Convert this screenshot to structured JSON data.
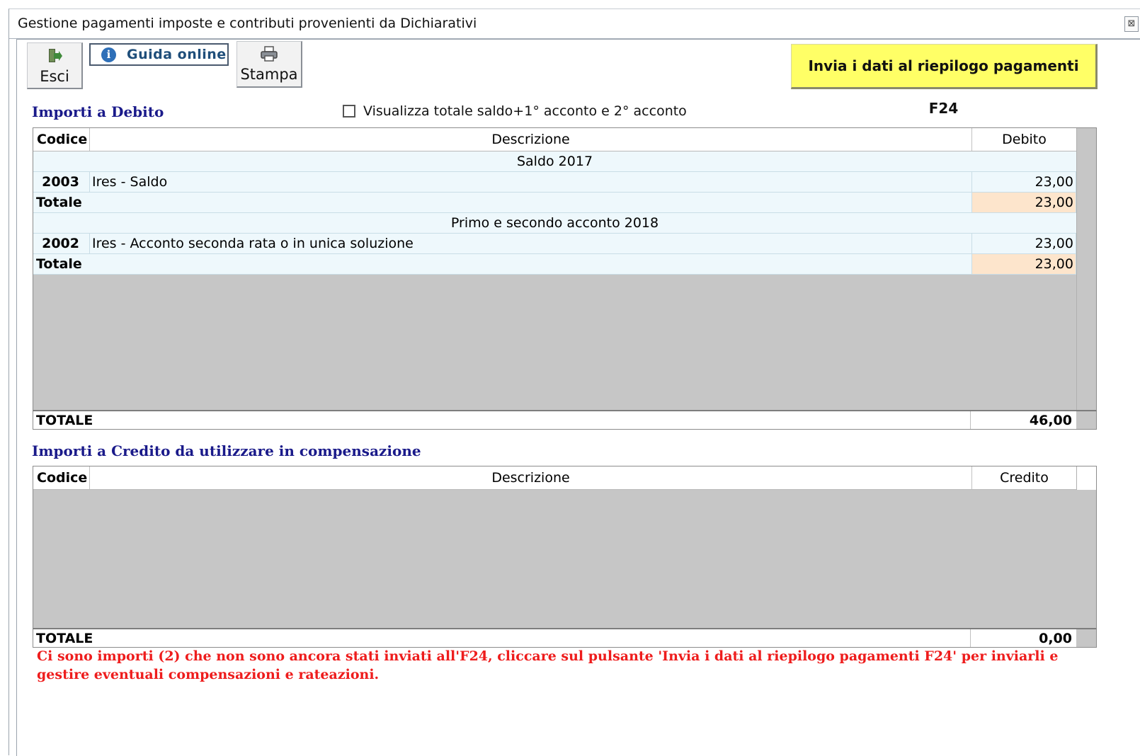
{
  "window": {
    "title": "Gestione pagamenti imposte e contributi provenienti da Dichiarativi",
    "close_icon": "⊠"
  },
  "toolbar": {
    "exit_label": "Esci",
    "guide_label": "Guida online",
    "print_label": "Stampa",
    "send_label": "Invia i dati al riepilogo pagamenti F24"
  },
  "debit": {
    "title": "Importi a Debito",
    "checkbox_label": "Visualizza totale saldo+1° acconto e 2° acconto",
    "columns": {
      "code": "Codice",
      "desc": "Descrizione",
      "amount": "Debito"
    },
    "groups": [
      {
        "label": "Saldo 2017",
        "rows": [
          {
            "code": "2003",
            "desc": "Ires - Saldo",
            "amount": "23,00"
          }
        ],
        "total_label": "Totale",
        "total": "23,00"
      },
      {
        "label": "Primo e secondo acconto 2018",
        "rows": [
          {
            "code": "2002",
            "desc": "Ires - Acconto seconda rata o in unica soluzione",
            "amount": "23,00"
          }
        ],
        "total_label": "Totale",
        "total": "23,00"
      }
    ],
    "grand_total_label": "TOTALE",
    "grand_total": "46,00"
  },
  "credit": {
    "title": "Importi a Credito da utilizzare in compensazione",
    "columns": {
      "code": "Codice",
      "desc": "Descrizione",
      "amount": "Credito"
    },
    "grand_total_label": "TOTALE",
    "grand_total": "0,00"
  },
  "warning": "Ci sono importi (2) che non sono ancora stati inviati all'F24, cliccare sul pulsante 'Invia i dati al riepilogo pagamenti F24' per inviarli e gestire eventuali compensazioni e rateazioni.",
  "colors": {
    "send_button": "#ffff66",
    "warning_text": "#ee1c1c",
    "section_title": "#1a1a8a",
    "row_bg": "#eef8fc",
    "total_highlight": "#fde5cc"
  }
}
